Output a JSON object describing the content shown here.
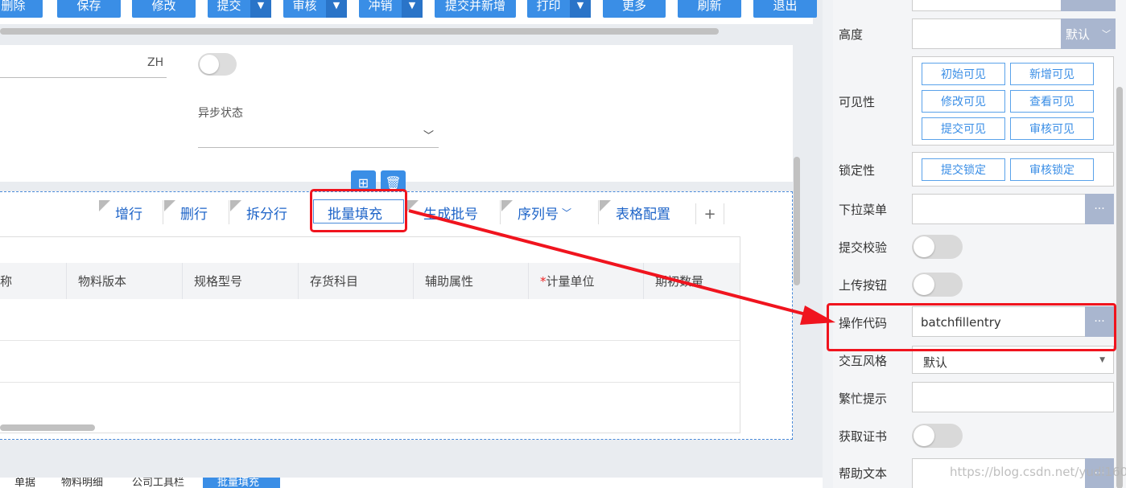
{
  "toolbar": {
    "buttons": [
      {
        "label": "删除"
      },
      {
        "label": "保存"
      },
      {
        "label": "修改"
      },
      {
        "label": "提交"
      },
      {
        "label": "审核"
      },
      {
        "label": "冲销"
      },
      {
        "label": "提交并新增"
      },
      {
        "label": "打印"
      },
      {
        "label": "更多"
      },
      {
        "label": "刷新"
      },
      {
        "label": "退出"
      }
    ]
  },
  "form": {
    "zh_value": "ZH",
    "async_label": "异步状态"
  },
  "grid_toolbar": {
    "items": [
      "增行",
      "删行",
      "拆分行",
      "批量填充",
      "生成批号",
      "序列号",
      "表格配置"
    ],
    "plus": "+"
  },
  "grid": {
    "columns": [
      "称",
      "物料版本",
      "规格型号",
      "存货科目",
      "辅助属性",
      "计量单位",
      "期初数量"
    ],
    "required_mark": "*"
  },
  "bottom_tabs": [
    "单据",
    "物料明细",
    "公司工具栏",
    "批量填充"
  ],
  "props": {
    "height_label": "高度",
    "height_unit": "默认",
    "visibility_label": "可见性",
    "visibility_buttons": [
      "初始可见",
      "新增可见",
      "修改可见",
      "查看可见",
      "提交可见",
      "审核可见"
    ],
    "lock_label": "锁定性",
    "lock_buttons": [
      "提交锁定",
      "审核锁定"
    ],
    "dropdown_label": "下拉菜单",
    "submit_check_label": "提交校验",
    "upload_label": "上传按钮",
    "op_code_label": "操作代码",
    "op_code_value": "batchfillentry",
    "interaction_label": "交互风格",
    "interaction_value": "默认",
    "busy_label": "繁忙提示",
    "cert_label": "获取证书",
    "help_label": "帮助文本",
    "dots": "···"
  },
  "watermark": "https://blog.csdn.net/yudi1602",
  "colors": {
    "accent": "#3a8ee6",
    "highlight": "#f0141e"
  }
}
